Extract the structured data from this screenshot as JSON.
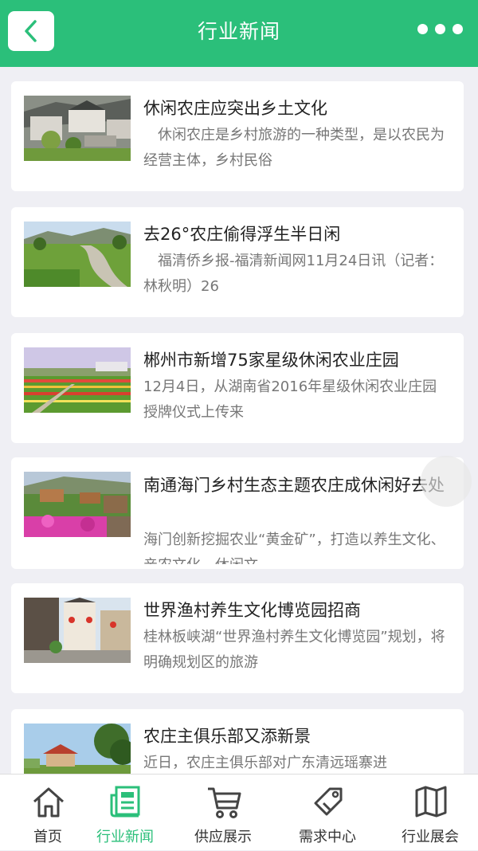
{
  "header": {
    "title": "行业新闻",
    "back_icon": "chevron-left-icon",
    "more_icon": "more-dots-icon"
  },
  "colors": {
    "brand": "#2bbf7a",
    "background": "#efeff4",
    "title_text": "#222222",
    "desc_text": "#777777"
  },
  "news": [
    {
      "title": "休闲农庄应突出乡土文化",
      "desc": "　休闲农庄是乡村旅游的一种类型，是以农民为经营主体，乡村民俗"
    },
    {
      "title": "去26°农庄偷得浮生半日闲",
      "desc": "　福清侨乡报-福清新闻网11月24日讯（记者：林秋明）26"
    },
    {
      "title": "郴州市新增75家星级休闲农业庄园",
      "desc": "12月4日，从湖南省2016年星级休闲农业庄园授牌仪式上传来"
    },
    {
      "title": "南通海门乡村生态主题农庄成休闲好去处",
      "desc": "海门创新挖掘农业“黄金矿”，打造以养生文化、亲农文化、休闲文"
    },
    {
      "title": "世界渔村养生文化博览园招商",
      "desc": "桂林板峡湖“世界渔村养生文化博览园”规划，将明确规划区的旅游"
    },
    {
      "title": "农庄主俱乐部又添新景",
      "desc": "近日，农庄主俱乐部对广东清远瑶寨进"
    }
  ],
  "tabbar": [
    {
      "label": "首页",
      "icon": "home-icon",
      "active": false
    },
    {
      "label": "行业新闻",
      "icon": "news-icon",
      "active": true
    },
    {
      "label": "供应展示",
      "icon": "cart-icon",
      "active": false
    },
    {
      "label": "需求中心",
      "icon": "tag-icon",
      "active": false
    },
    {
      "label": "行业展会",
      "icon": "map-icon",
      "active": false
    }
  ]
}
